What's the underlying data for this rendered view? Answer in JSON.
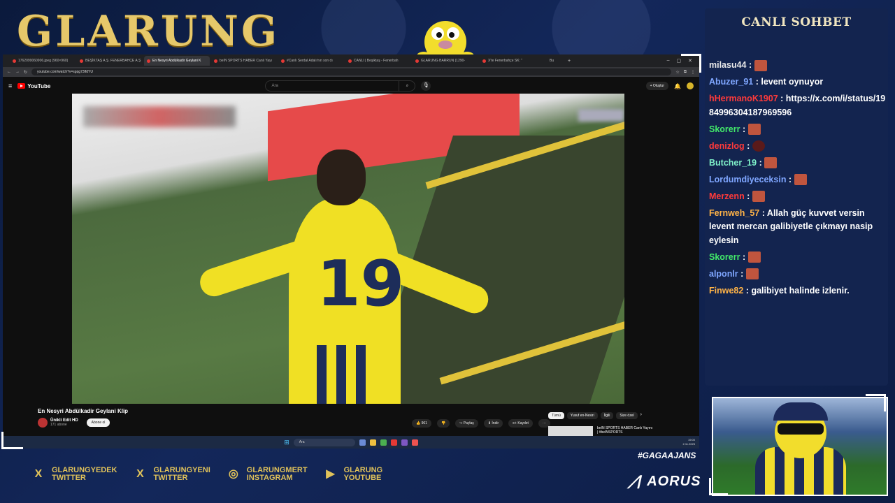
{
  "overlay": {
    "logo": "GLARUNG",
    "chat_title": "CANLI SOHBET",
    "hashtag": "#GAGAAJANS",
    "sponsor": "AORUS"
  },
  "browser": {
    "tabs": [
      {
        "label": "1762099060906.jpeg (960×960)",
        "active": false
      },
      {
        "label": "BEŞİKTAŞ A.Ş. FENERBAHÇE A.Ş",
        "active": false
      },
      {
        "label": "En Nesyri Abdülkadir Geylani K",
        "active": true
      },
      {
        "label": "beIN SPORTS HABER Canlı Yayı",
        "active": false
      },
      {
        "label": "#Canlı Serdal Adalı'nın son dı",
        "active": false
      },
      {
        "label": "CANLI | Beşiktaş - Fenerbah",
        "active": false
      },
      {
        "label": "GLARUNG BARRUN (1290-",
        "active": false
      },
      {
        "label": "X'te Fenerbahçe SK: \"",
        "active": false
      },
      {
        "label": "Bu",
        "active": false
      }
    ],
    "url": "youtube.com/watch?v=sgqg73lfdYU"
  },
  "youtube": {
    "logo_text": "YouTube",
    "search_placeholder": "Ara",
    "create_label": "+ Oluştur",
    "video_title": "En Nesyri Abdülkadir Geylani Klip",
    "channel_name": "Ünikli Edit HD",
    "subscribers": "171 abone",
    "subscribe_label": "Abone ol",
    "like_count": "961",
    "share_label": "Paylaş",
    "download_label": "İndir",
    "save_label": "Kaydet",
    "chips": [
      "Tümü",
      "Yusuf en-Nesiri",
      "İlgili",
      "Size özel"
    ],
    "rec_title": "beIN SPORTS HABER Canlı Yayını | #beINSPORTS",
    "jersey_number": "19"
  },
  "taskbar": {
    "search_placeholder": "Ara",
    "time": "19:00",
    "date": "2.11.2025"
  },
  "chat": {
    "messages": [
      {
        "user": "milasu44",
        "color": "#e9e9e9",
        "text": "",
        "emote": "face"
      },
      {
        "user": "Abuzer_91",
        "color": "#7fa6ff",
        "text": "levent oynuyor",
        "emote": ""
      },
      {
        "user": "hHermanoK1907",
        "color": "#ff3a3a",
        "text": "https://x.com/i/status/1984996304187969596",
        "emote": ""
      },
      {
        "user": "Skorerr",
        "color": "#42e86a",
        "text": "",
        "emote": "face"
      },
      {
        "user": "denizlog",
        "color": "#ff3a3a",
        "text": "",
        "emote": "dark"
      },
      {
        "user": "Butcher_19",
        "color": "#7ff0c9",
        "text": "",
        "emote": "face"
      },
      {
        "user": "Lordumdiyeceksin",
        "color": "#7fa6ff",
        "text": "",
        "emote": "face"
      },
      {
        "user": "Merzenn",
        "color": "#ff3a3a",
        "text": "",
        "emote": "face"
      },
      {
        "user": "Fernweh_57",
        "color": "#ffb347",
        "text": "Allah güç kuvvet versin levent mercan galibiyetle çıkmayı nasip eylesin",
        "emote": ""
      },
      {
        "user": "Skorerr",
        "color": "#42e86a",
        "text": "",
        "emote": "face"
      },
      {
        "user": "alponlr",
        "color": "#7fa6ff",
        "text": "",
        "emote": "face"
      },
      {
        "user": "Finwe82",
        "color": "#ffb347",
        "text": "galibiyet halinde izlenir.",
        "emote": ""
      }
    ]
  },
  "socials": [
    {
      "icon": "X",
      "line1": "GLARUNGYEDEK",
      "line2": "TWITTER"
    },
    {
      "icon": "X",
      "line1": "GLARUNGYENI",
      "line2": "TWITTER"
    },
    {
      "icon": "◎",
      "line1": "GLARUNGMERT",
      "line2": "INSTAGRAM"
    },
    {
      "icon": "▶",
      "line1": "GLARUNG",
      "line2": "YOUTUBE"
    }
  ]
}
